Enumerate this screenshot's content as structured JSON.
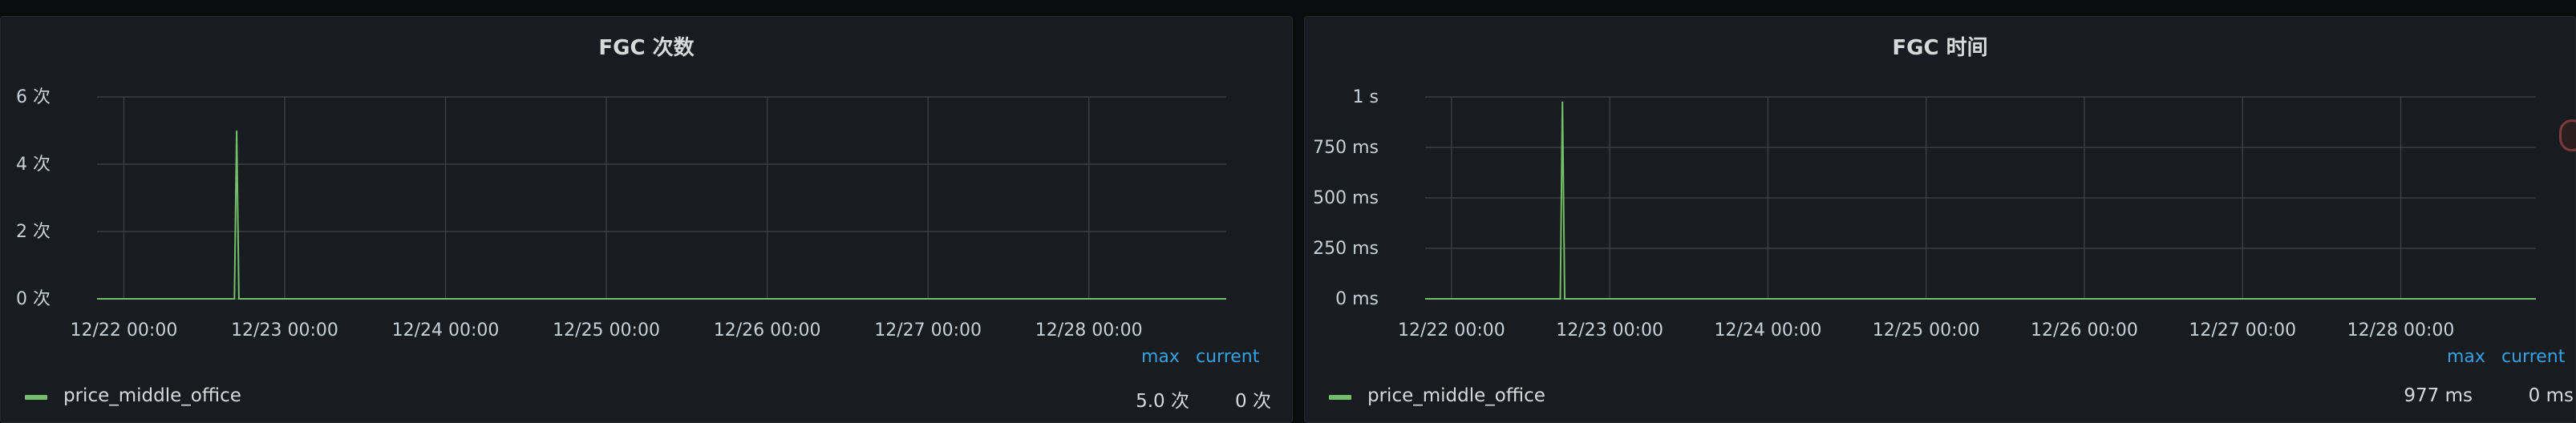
{
  "panels": [
    {
      "title": "FGC 次数",
      "legend": {
        "headers": {
          "max": "max",
          "current": "current"
        },
        "series_name": "price_middle_office",
        "max_value": "5.0 次",
        "current_value": "0 次"
      },
      "y_ticks": [
        "0 次",
        "2 次",
        "4 次",
        "6 次"
      ],
      "x_ticks": [
        "12/22 00:00",
        "12/23 00:00",
        "12/24 00:00",
        "12/25 00:00",
        "12/26 00:00",
        "12/27 00:00",
        "12/28 00:00"
      ]
    },
    {
      "title": "FGC 时间",
      "legend": {
        "headers": {
          "max": "max",
          "current": "current"
        },
        "series_name": "price_middle_office",
        "max_value": "977 ms",
        "current_value": "0 ms"
      },
      "y_ticks": [
        "0 ms",
        "250 ms",
        "500 ms",
        "750 ms",
        "1 s"
      ],
      "x_ticks": [
        "12/22 00:00",
        "12/23 00:00",
        "12/24 00:00",
        "12/25 00:00",
        "12/26 00:00",
        "12/27 00:00",
        "12/28 00:00"
      ]
    }
  ],
  "colors": {
    "series": "#73bf69",
    "legend_header": "#33a2e5",
    "grid": "#3a3d42"
  },
  "chart_data": [
    {
      "type": "line",
      "title": "FGC 次数",
      "unit": "次",
      "x_range": [
        "12/21 20:00",
        "12/28 20:30"
      ],
      "ylim": [
        0,
        6
      ],
      "y_tick_values": [
        0,
        2,
        4,
        6
      ],
      "grid": true,
      "legend_placement": "bottom",
      "series": [
        {
          "name": "price_middle_office",
          "points": [
            [
              "12/21 20:00",
              0
            ],
            [
              "12/22 16:30",
              0
            ],
            [
              "12/22 16:50",
              5
            ],
            [
              "12/22 17:10",
              0
            ],
            [
              "12/28 20:30",
              0
            ]
          ]
        }
      ]
    },
    {
      "type": "line",
      "title": "FGC 时间",
      "unit": "ms",
      "x_range": [
        "12/21 20:00",
        "12/28 20:30"
      ],
      "ylim": [
        0,
        1000
      ],
      "y_tick_values": [
        0,
        250,
        500,
        750,
        1000
      ],
      "grid": true,
      "legend_placement": "bottom",
      "series": [
        {
          "name": "price_middle_office",
          "points": [
            [
              "12/21 20:00",
              0
            ],
            [
              "12/22 16:30",
              0
            ],
            [
              "12/22 16:50",
              977
            ],
            [
              "12/22 17:10",
              0
            ],
            [
              "12/28 20:30",
              0
            ]
          ]
        }
      ]
    }
  ]
}
